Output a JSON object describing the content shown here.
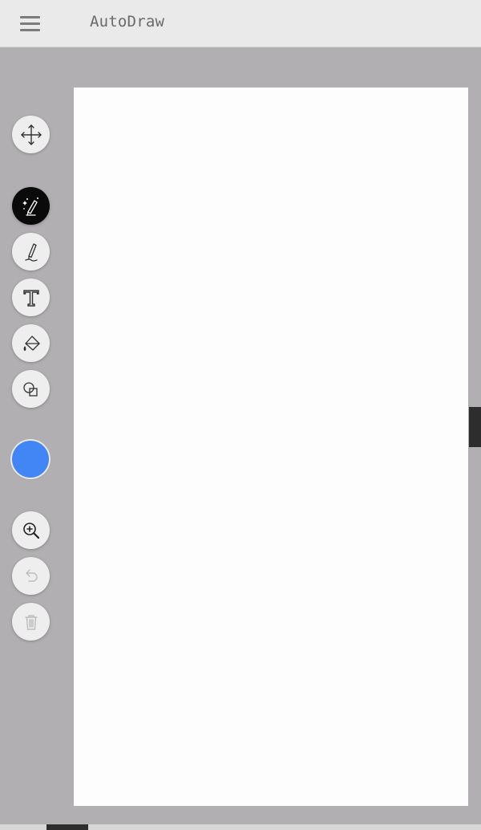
{
  "header": {
    "title": "AutoDraw",
    "menu_icon": "hamburger-menu-icon"
  },
  "toolbar": {
    "tools": [
      {
        "name": "select",
        "icon": "move-icon",
        "state": "enabled"
      },
      {
        "name": "autodraw",
        "icon": "autodraw-sparkle-pencil-icon",
        "state": "active"
      },
      {
        "name": "draw",
        "icon": "pencil-icon",
        "state": "enabled"
      },
      {
        "name": "type",
        "icon": "text-icon",
        "state": "enabled"
      },
      {
        "name": "fill",
        "icon": "paint-bucket-icon",
        "state": "enabled"
      },
      {
        "name": "shape",
        "icon": "shapes-icon",
        "state": "enabled"
      },
      {
        "name": "zoom",
        "icon": "zoom-in-icon",
        "state": "enabled"
      },
      {
        "name": "undo",
        "icon": "undo-icon",
        "state": "disabled"
      },
      {
        "name": "delete",
        "icon": "trash-icon",
        "state": "disabled"
      }
    ],
    "current_color": "#4285f4"
  },
  "colors": {
    "topbar_bg": "#ebeaeb",
    "workspace_bg": "#b1afb1",
    "canvas_bg": "#fefdfe",
    "active_tool_bg": "#0a0a0a"
  }
}
